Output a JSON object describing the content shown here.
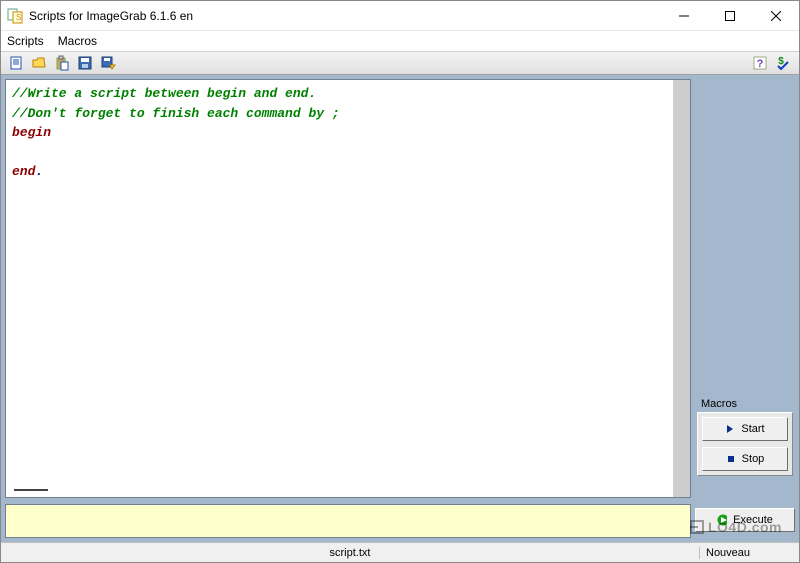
{
  "titlebar": {
    "title": "Scripts for ImageGrab 6.1.6 en"
  },
  "menubar": {
    "scripts": "Scripts",
    "macros": "Macros"
  },
  "toolbar": {
    "new": "New",
    "open": "Open",
    "paste": "Paste",
    "save": "Save",
    "saveas": "Save As",
    "help": "Help",
    "check": "Check"
  },
  "editor": {
    "line1": "//Write a script between begin and end.",
    "line2": "//Don't forget to finish each command by ;",
    "begin": "begin",
    "end": "end",
    "dot": "."
  },
  "macros": {
    "group_label": "Macros",
    "start": "Start",
    "stop": "Stop"
  },
  "execute": {
    "label": "Execute"
  },
  "statusbar": {
    "filename": "script.txt",
    "status": "Nouveau"
  },
  "watermark": "LO4D.com"
}
